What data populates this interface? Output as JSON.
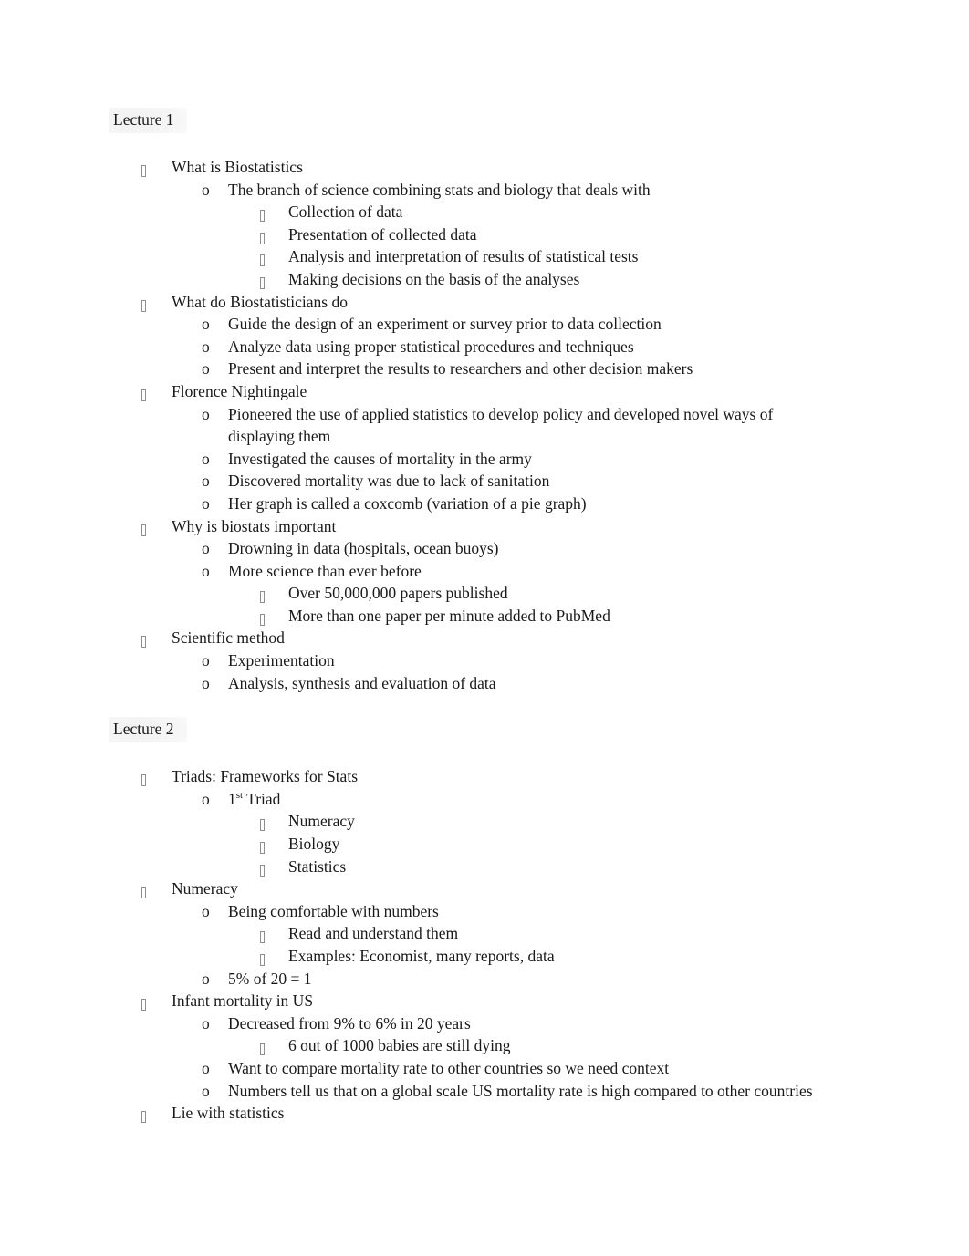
{
  "document": {
    "background_color": "#ffffff",
    "text_color": "#1a1a1a",
    "bullet_color": "#8e8e8e",
    "heading_highlight_color": "#eeeeee"
  },
  "sections": [
    {
      "heading": "Lecture 1",
      "items": [
        {
          "level": 1,
          "marker": "tofu-box",
          "text": "What is Biostatistics"
        },
        {
          "level": 2,
          "marker": "letter-o",
          "text": "The branch of science combining stats and biology that deals with"
        },
        {
          "level": 3,
          "marker": "tofu-box",
          "text": "Collection of data"
        },
        {
          "level": 3,
          "marker": "tofu-box",
          "text": "Presentation of collected data"
        },
        {
          "level": 3,
          "marker": "tofu-box",
          "text": "Analysis and interpretation of results of statistical tests"
        },
        {
          "level": 3,
          "marker": "tofu-box",
          "text": "Making decisions on the basis of the analyses"
        },
        {
          "level": 1,
          "marker": "tofu-box",
          "text": "What do Biostatisticians do"
        },
        {
          "level": 2,
          "marker": "letter-o",
          "text": "Guide the design of an experiment or survey prior to data collection"
        },
        {
          "level": 2,
          "marker": "letter-o",
          "text": "Analyze data using proper statistical procedures and techniques"
        },
        {
          "level": 2,
          "marker": "letter-o",
          "text": "Present and interpret the results to researchers and other decision makers"
        },
        {
          "level": 1,
          "marker": "tofu-box",
          "text": "Florence Nightingale"
        },
        {
          "level": 2,
          "marker": "letter-o",
          "text": "Pioneered the use of applied statistics to develop policy and developed novel ways of displaying them"
        },
        {
          "level": 2,
          "marker": "letter-o",
          "text": "Investigated the causes of mortality in the army"
        },
        {
          "level": 2,
          "marker": "letter-o",
          "text": "Discovered mortality was due to lack of sanitation"
        },
        {
          "level": 2,
          "marker": "letter-o",
          "text": "Her graph is called a coxcomb (variation of a pie graph)"
        },
        {
          "level": 1,
          "marker": "tofu-box",
          "text": "Why is biostats important"
        },
        {
          "level": 2,
          "marker": "letter-o",
          "text": "Drowning in data (hospitals, ocean buoys)"
        },
        {
          "level": 2,
          "marker": "letter-o",
          "text": "More science than ever before"
        },
        {
          "level": 3,
          "marker": "tofu-box",
          "text": "Over 50,000,000 papers published"
        },
        {
          "level": 3,
          "marker": "tofu-box",
          "text": "More than one paper per minute added to PubMed"
        },
        {
          "level": 1,
          "marker": "tofu-box",
          "text": "Scientific method"
        },
        {
          "level": 2,
          "marker": "letter-o",
          "text": "Experimentation"
        },
        {
          "level": 2,
          "marker": "letter-o",
          "text": "Analysis, synthesis and evaluation of data"
        }
      ]
    },
    {
      "heading": "Lecture 2",
      "items": [
        {
          "level": 1,
          "marker": "tofu-box",
          "text": "Triads: Frameworks for Stats"
        },
        {
          "level": 2,
          "marker": "letter-o",
          "text": "1st Triad",
          "text_prefix": "1",
          "text_superscript": "st",
          "text_suffix": " Triad"
        },
        {
          "level": 3,
          "marker": "tofu-box",
          "text": "Numeracy"
        },
        {
          "level": 3,
          "marker": "tofu-box",
          "text": "Biology"
        },
        {
          "level": 3,
          "marker": "tofu-box",
          "text": "Statistics"
        },
        {
          "level": 1,
          "marker": "tofu-box",
          "text": "Numeracy"
        },
        {
          "level": 2,
          "marker": "letter-o",
          "text": "Being comfortable with numbers"
        },
        {
          "level": 3,
          "marker": "tofu-box",
          "text": "Read and understand them"
        },
        {
          "level": 3,
          "marker": "tofu-box",
          "text": "Examples: Economist, many reports, data"
        },
        {
          "level": 2,
          "marker": "letter-o",
          "text": "5% of 20 = 1"
        },
        {
          "level": 1,
          "marker": "tofu-box",
          "text": "Infant mortality in US"
        },
        {
          "level": 2,
          "marker": "letter-o",
          "text": "Decreased from 9% to 6% in 20 years"
        },
        {
          "level": 3,
          "marker": "tofu-box",
          "text": "6 out of 1000 babies are still dying"
        },
        {
          "level": 2,
          "marker": "letter-o",
          "text": "Want to compare mortality rate to other countries so we need context"
        },
        {
          "level": 2,
          "marker": "letter-o",
          "text": "Numbers tell us that on a global scale US mortality rate is high compared to other countries"
        },
        {
          "level": 1,
          "marker": "tofu-box",
          "text": "Lie with statistics"
        }
      ]
    }
  ],
  "markers": {
    "letter_o": "o"
  }
}
